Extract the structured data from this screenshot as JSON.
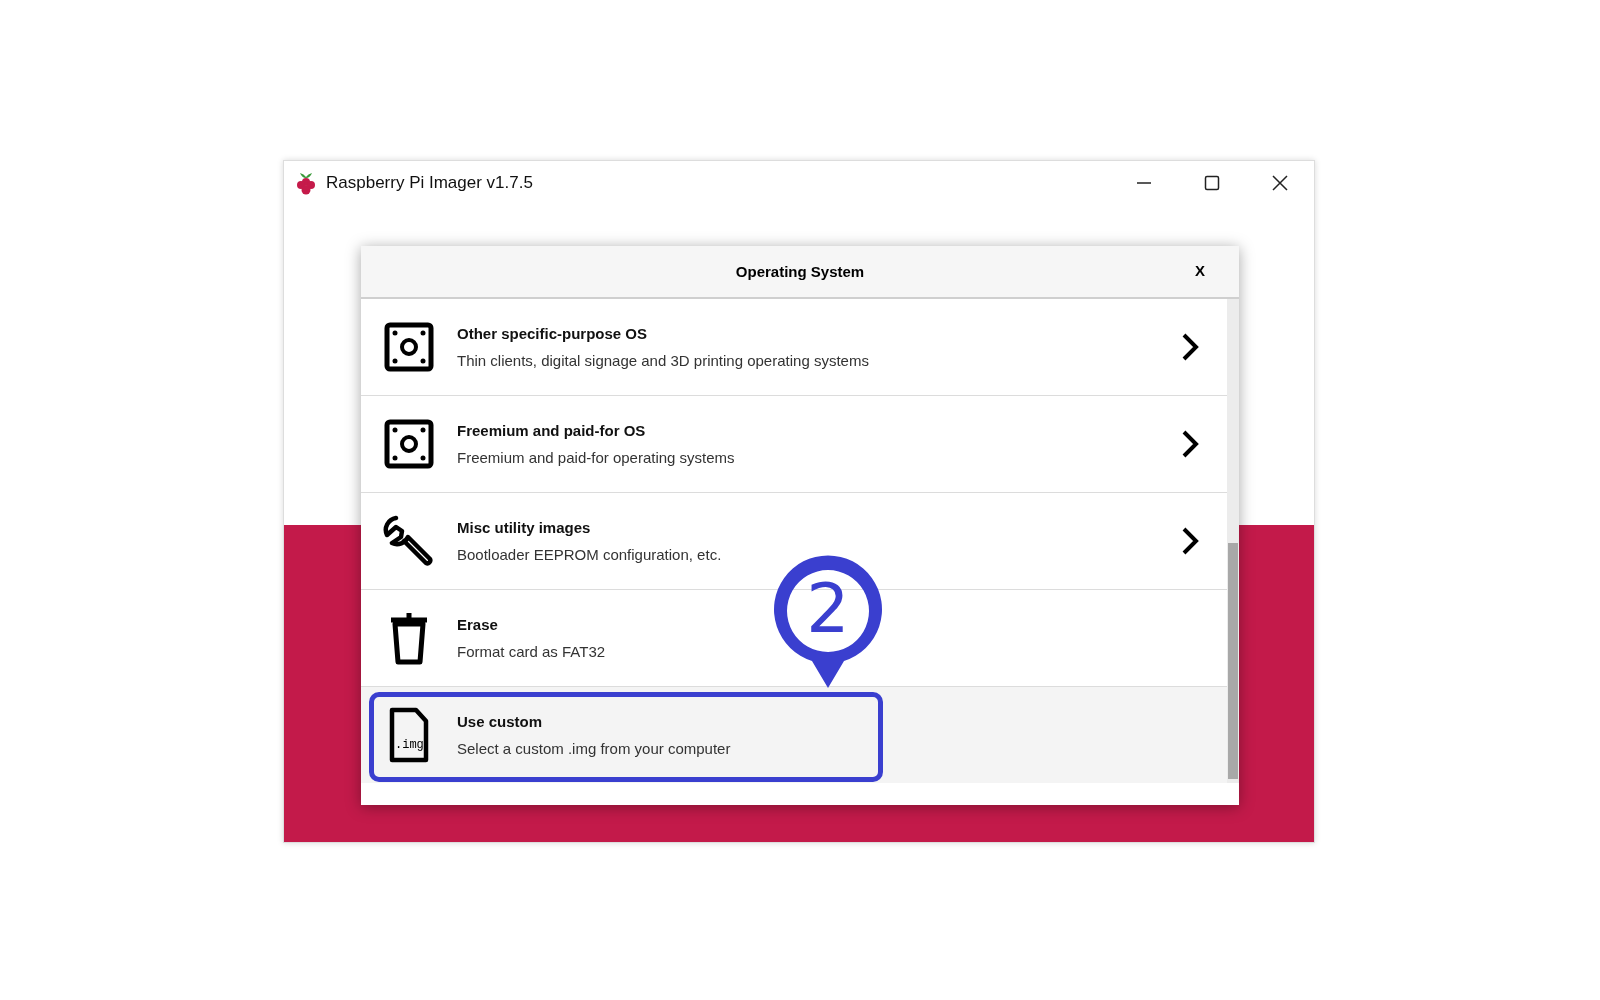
{
  "window": {
    "title": "Raspberry Pi Imager v1.7.5"
  },
  "dialog": {
    "title": "Operating System",
    "close_label": "X"
  },
  "items": [
    {
      "kind": "category",
      "title": "Other specific-purpose OS",
      "description": "Thin clients, digital signage and 3D printing operating systems",
      "selected": false,
      "outlined": false
    },
    {
      "kind": "category",
      "title": "Freemium and paid-for OS",
      "description": "Freemium and paid-for operating systems",
      "selected": false,
      "outlined": false
    },
    {
      "kind": "category",
      "title": "Misc utility images",
      "description": "Bootloader EEPROM configuration, etc.",
      "selected": false,
      "outlined": false
    },
    {
      "kind": "action",
      "title": "Erase",
      "description": "Format card as FAT32",
      "selected": false,
      "outlined": false
    },
    {
      "kind": "action",
      "icon_label": ".img",
      "title": "Use custom",
      "description": "Select a custom .img from your computer",
      "selected": true,
      "outlined": true
    }
  ],
  "callout": {
    "number": "2"
  }
}
